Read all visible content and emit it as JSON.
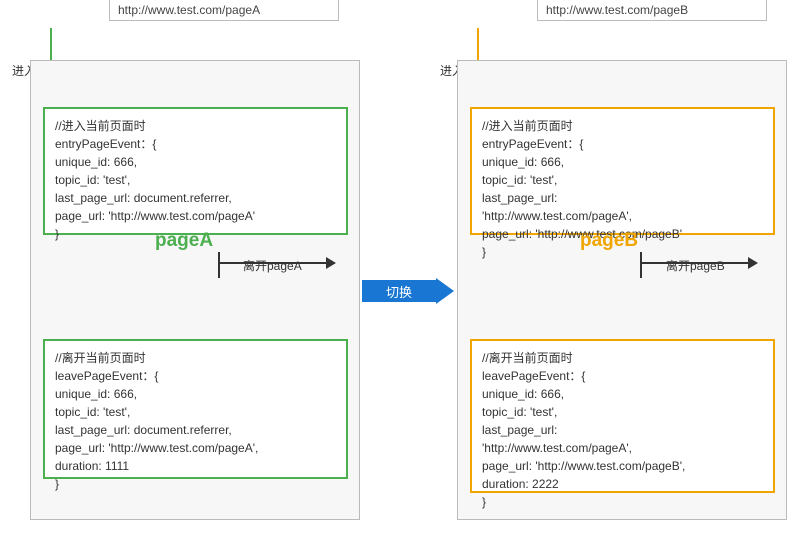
{
  "pageA": {
    "enter_label": "进入pageA",
    "url": "http://www.test.com/pageA",
    "title": "pageA",
    "leave_label": "离开pageA",
    "entry_code": "//进入当前页面时\nentryPageEvent：{\nunique_id: 666,\ntopic_id: 'test',\nlast_page_url: document.referrer,\npage_url: 'http://www.test.com/pageA'\n}",
    "leave_code": "//离开当前页面时\nleavePageEvent：{\nunique_id: 666,\ntopic_id: 'test',\nlast_page_url: document.referrer,\npage_url: 'http://www.test.com/pageA',\nduration: 1111\n}"
  },
  "pageB": {
    "enter_label": "进入pageB",
    "url": "http://www.test.com/pageB",
    "title": "pageB",
    "leave_label": "离开pageB",
    "entry_code": "//进入当前页面时\nentryPageEvent：{\nunique_id: 666,\ntopic_id: 'test',\nlast_page_url:\n'http://www.test.com/pageA',\npage_url: 'http://www.test.com/pageB'\n}",
    "leave_code": "//离开当前页面时\nleavePageEvent：{\nunique_id: 666,\ntopic_id: 'test',\nlast_page_url:\n'http://www.test.com/pageA',\npage_url: 'http://www.test.com/pageB',\nduration: 2222\n}"
  },
  "switch_label": "切换",
  "colors": {
    "green": "#4CAF50",
    "orange": "#f0a500",
    "blue": "#1976d2"
  }
}
